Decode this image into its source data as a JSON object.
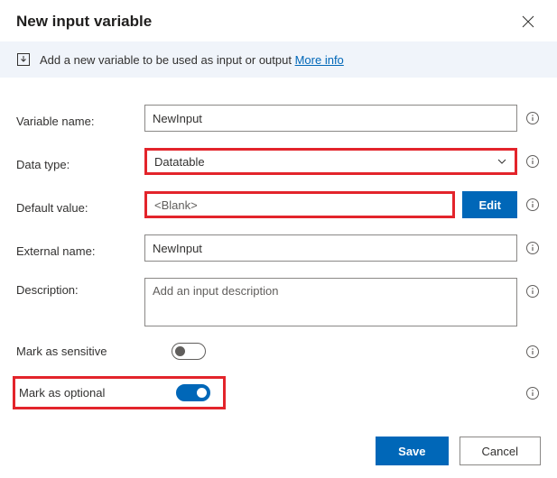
{
  "header": {
    "title": "New input variable"
  },
  "banner": {
    "text": "Add a new variable to be used as input or output",
    "link_label": "More info"
  },
  "labels": {
    "variable_name": "Variable name:",
    "data_type": "Data type:",
    "default_value": "Default value:",
    "external_name": "External name:",
    "description": "Description:",
    "mark_sensitive": "Mark as sensitive",
    "mark_optional": "Mark as optional"
  },
  "fields": {
    "variable_name": "NewInput",
    "data_type": "Datatable",
    "default_value": "<Blank>",
    "external_name": "NewInput",
    "description_placeholder": "Add an input description"
  },
  "toggles": {
    "sensitive": false,
    "optional": true
  },
  "buttons": {
    "edit": "Edit",
    "save": "Save",
    "cancel": "Cancel"
  }
}
